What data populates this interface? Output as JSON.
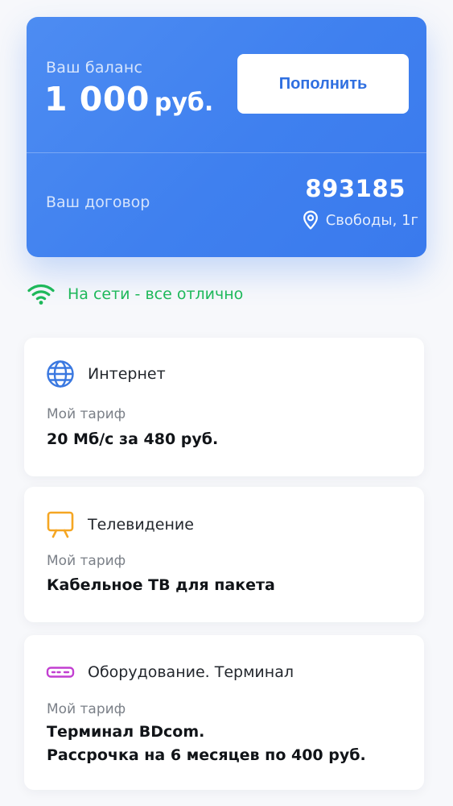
{
  "balance": {
    "label": "Ваш баланс",
    "amount": "1 000",
    "currency": "руб.",
    "topup_label": "Пополнить"
  },
  "contract": {
    "label": "Ваш договор",
    "number": "893185",
    "address": "Свободы, 1г"
  },
  "status": {
    "text": "На сети - все отлично",
    "color": "#1eb85a"
  },
  "services": [
    {
      "icon": "globe-icon",
      "title": "Интернет",
      "tariff_label": "Мой тариф",
      "tariff_lines": [
        "20 Мб/с за 480 руб."
      ]
    },
    {
      "icon": "tv-icon",
      "title": "Телевидение",
      "tariff_label": "Мой тариф",
      "tariff_lines": [
        "Кабельное ТВ для пакета"
      ]
    },
    {
      "icon": "terminal-icon",
      "title": "Оборудование. Терминал",
      "tariff_label": "Мой тариф",
      "tariff_lines": [
        "Терминал BDcom.",
        "Рассрочка на 6 месяцев по 400 руб."
      ]
    }
  ],
  "colors": {
    "accent": "#3f80ef",
    "internet_icon": "#3a78e0",
    "tv_icon": "#f5a623",
    "terminal_icon": "#c23fd1"
  }
}
